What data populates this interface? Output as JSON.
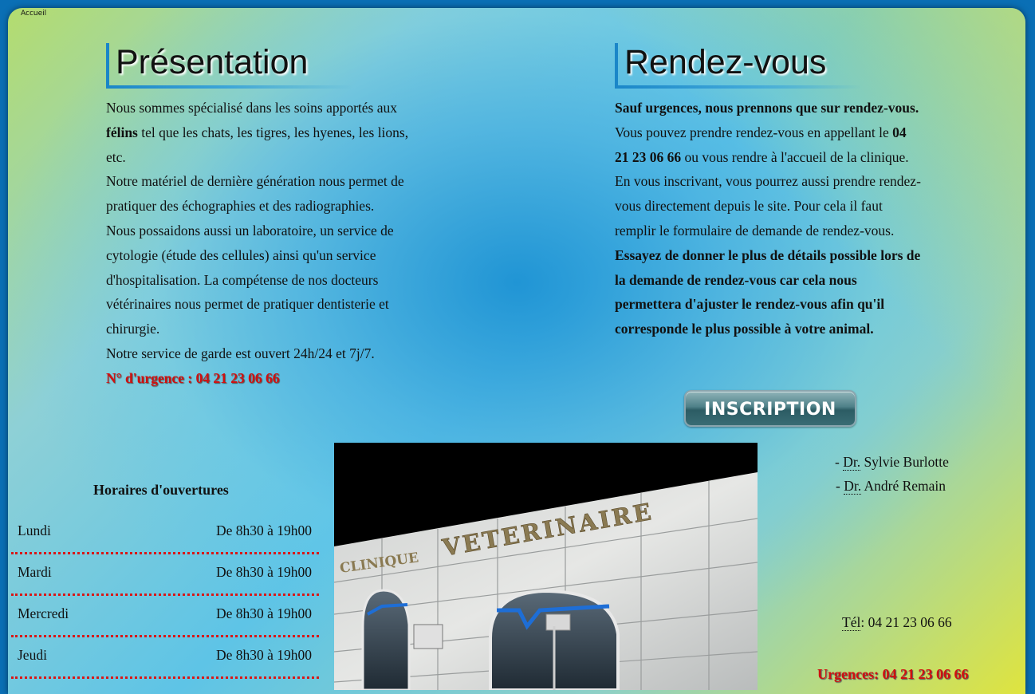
{
  "nav": {
    "home_label": "Accueil"
  },
  "presentation": {
    "title": "Présentation",
    "p1_a": "Nous sommes spécialisé dans les soins apportés aux ",
    "p1_bold": "félins",
    "p1_b": " tel que les chats, les tigres, les hyenes, les lions, etc.",
    "p2": "Notre matériel de dernière génération nous permet de pratiquer des échographies et des radiographies.",
    "p3": "Nous possaidons aussi un laboratoire, un service de cytologie (étude des cellules) ainsi qu'un service d'hospitalisation. La compétense de nos docteurs vétérinaires nous permet de pratiquer dentisterie et chirurgie.",
    "p4": "Notre service de garde est ouvert 24h/24 et 7j/7.",
    "urgent": "N° d'urgence : 04 21 23 06 66"
  },
  "rdv": {
    "title": "Rendez-vous",
    "p1_bold": "Sauf urgences, nous prennons que sur rendez-vous.",
    "p1_a": " Vous pouvez prendre rendez-vous en appellant le ",
    "p1_phone": "04 21 23 06 66",
    "p1_b": " ou vous rendre à l'accueil de la clinique.",
    "p2": "En vous inscrivant, vous pourrez aussi prendre rendez-vous directement depuis le site. Pour cela il faut remplir le formulaire de demande de rendez-vous. ",
    "p2_bold": "Essayez de donner le plus de détails possible lors de la demande de rendez-vous car cela nous permettera d'ajuster le rendez-vous afin qu'il corresponde le plus possible à votre animal.",
    "button_label": "INSCRIPTION"
  },
  "hours": {
    "title": "Horaires d'ouvertures",
    "rows": [
      {
        "day": "Lundi",
        "time": "De 8h30 à 19h00"
      },
      {
        "day": "Mardi",
        "time": "De 8h30 à 19h00"
      },
      {
        "day": "Mercredi",
        "time": "De 8h30 à 19h00"
      },
      {
        "day": "Jeudi",
        "time": "De 8h30 à 19h00"
      }
    ]
  },
  "photo": {
    "sign_line1": "CLINIQUE",
    "sign_line2": "VETERINAIRE"
  },
  "contact": {
    "doctors": [
      {
        "prefix": "- ",
        "title": "Dr.",
        "name": " Sylvie Burlotte"
      },
      {
        "prefix": "- ",
        "title": "Dr.",
        "name": " André Remain"
      }
    ],
    "tel_label": "Tél",
    "tel_value": ": 04 21 23 06 66",
    "urgences": "Urgences: 04 21 23 06 66"
  }
}
